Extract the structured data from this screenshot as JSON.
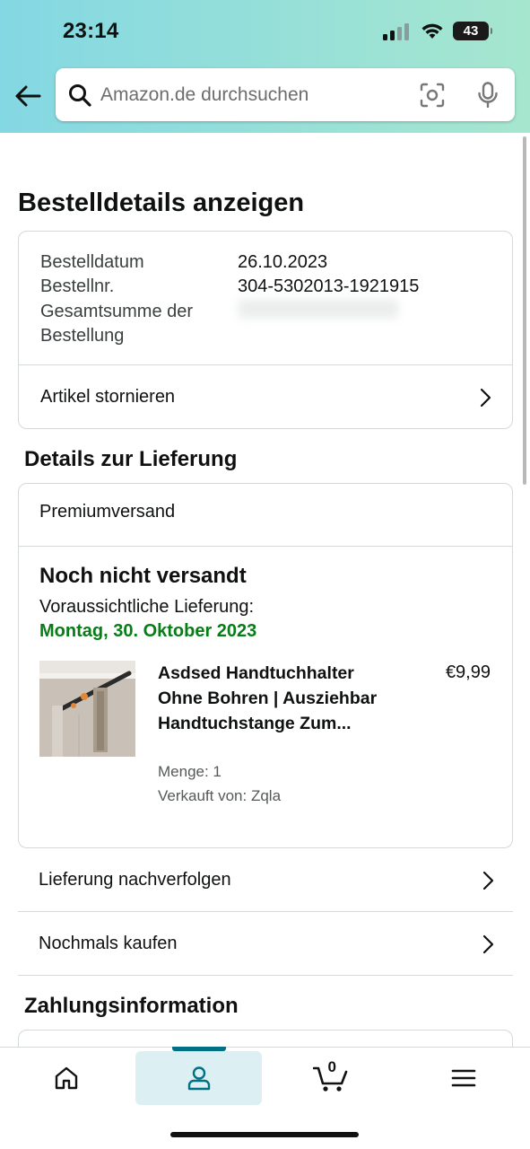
{
  "status_bar": {
    "time": "23:14",
    "battery": "43"
  },
  "header": {
    "search_placeholder": "Amazon.de durchsuchen"
  },
  "page_title": "Bestelldetails anzeigen",
  "order_summary": {
    "order_date_label": "Bestelldatum",
    "order_date": "26.10.2023",
    "order_number_label": "Bestellnr.",
    "order_number": "304-5302013-1921915",
    "total_label_line1": "Gesamtsumme der",
    "total_label_line2": "Bestellung",
    "cancel_label": "Artikel stornieren"
  },
  "delivery": {
    "heading": "Details zur Lieferung",
    "shipping_type": "Premiumversand",
    "status": "Noch nicht versandt",
    "eta_label": "Voraussichtliche Lieferung:",
    "eta_date": "Montag, 30. Oktober 2023",
    "item": {
      "title": "Asdsed Handtuchhalter Ohne Bohren | Ausziehbar Handtuchstange Zum...",
      "price": "€9,99",
      "quantity": "Menge: 1",
      "seller": "Verkauft von: Zqla"
    },
    "track_label": "Lieferung nachverfolgen",
    "buy_again_label": "Nochmals kaufen"
  },
  "payment": {
    "heading": "Zahlungsinformation"
  },
  "bottom_nav": {
    "cart_count": "0"
  },
  "colors": {
    "accent_green": "#067d16",
    "nav_active": "#007185",
    "header_left": "#84d8e3",
    "header_right": "#a6e6cf"
  }
}
